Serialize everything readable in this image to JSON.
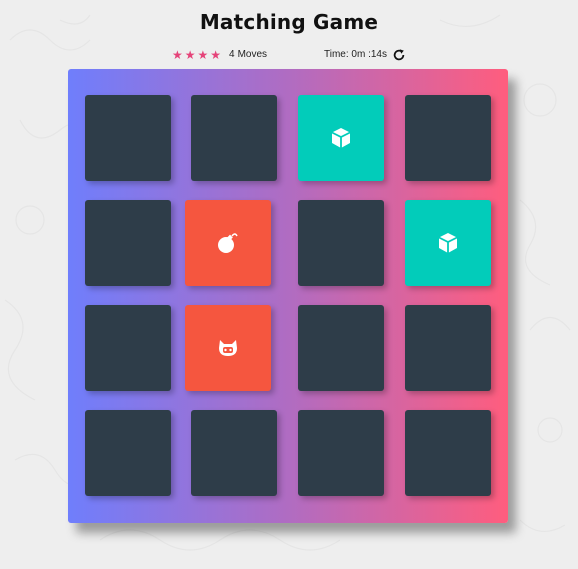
{
  "title": "Matching Game",
  "score_panel": {
    "stars": [
      "★",
      "★",
      "★",
      "★"
    ],
    "moves_count": "4",
    "moves_label": "Moves",
    "timer_label": "Time: 0m :14s",
    "restart_icon": "rotate-right-icon"
  },
  "colors": {
    "card_hidden": "#2e3d49",
    "card_open": "#f5563f",
    "card_match": "#02ccba",
    "deck_gradient_start": "#6f7efc",
    "deck_gradient_end": "#ff5d7e",
    "star": "#e54379"
  },
  "deck": {
    "rows": 4,
    "cols": 4,
    "cards": [
      {
        "state": "hidden",
        "icon": ""
      },
      {
        "state": "hidden",
        "icon": ""
      },
      {
        "state": "match",
        "icon": "cube-icon"
      },
      {
        "state": "hidden",
        "icon": ""
      },
      {
        "state": "hidden",
        "icon": ""
      },
      {
        "state": "open",
        "icon": "bomb-icon"
      },
      {
        "state": "hidden",
        "icon": ""
      },
      {
        "state": "match",
        "icon": "cube-icon"
      },
      {
        "state": "hidden",
        "icon": ""
      },
      {
        "state": "open",
        "icon": "github-cat-icon"
      },
      {
        "state": "hidden",
        "icon": ""
      },
      {
        "state": "hidden",
        "icon": ""
      },
      {
        "state": "hidden",
        "icon": ""
      },
      {
        "state": "hidden",
        "icon": ""
      },
      {
        "state": "hidden",
        "icon": ""
      },
      {
        "state": "hidden",
        "icon": ""
      }
    ]
  }
}
